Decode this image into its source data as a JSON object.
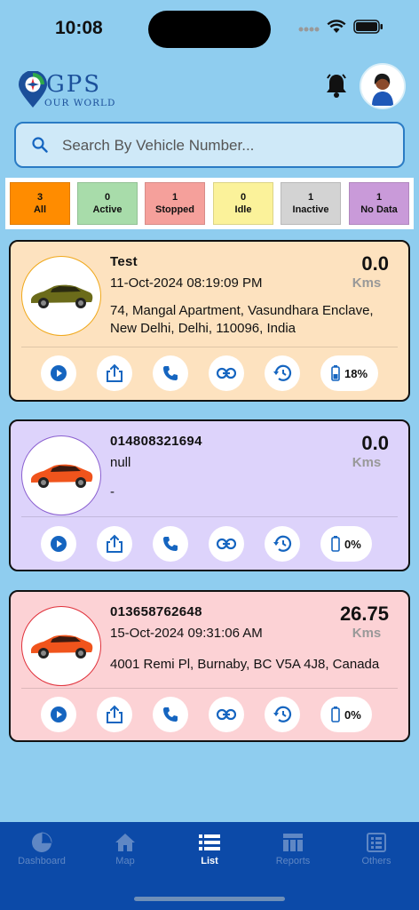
{
  "status_bar": {
    "time": "10:08"
  },
  "header": {
    "logo_main": "GPS",
    "logo_sub": "OUR WORLD"
  },
  "search": {
    "placeholder": "Search By Vehicle Number..."
  },
  "filters": [
    {
      "count": "3",
      "label": "All",
      "color": "#ff8c00"
    },
    {
      "count": "0",
      "label": "Active",
      "color": "#a8dcaa"
    },
    {
      "count": "1",
      "label": "Stopped",
      "color": "#f5a09b"
    },
    {
      "count": "0",
      "label": "Idle",
      "color": "#fbf29a"
    },
    {
      "count": "1",
      "label": "Inactive",
      "color": "#d3d3d3"
    },
    {
      "count": "1",
      "label": "No Data",
      "color": "#c99ad9"
    }
  ],
  "vehicles": [
    {
      "name": "Test",
      "time": "11-Oct-2024 08:19:09 PM",
      "address": "74, Mangal Apartment, Vasundhara Enclave, New Delhi, Delhi, 110096, India",
      "distance": "0.0",
      "unit": "Kms",
      "battery": "18%",
      "card_color": "#fde2bf",
      "ring_color": "#f0a81a",
      "car_color": "#6b6b1a",
      "car_icon": "car-icon"
    },
    {
      "name": "014808321694",
      "time": "null",
      "address": "-",
      "distance": "0.0",
      "unit": "Kms",
      "battery": "0%",
      "card_color": "#ddd3fb",
      "ring_color": "#8a5fd0",
      "car_color": "#f0541c",
      "car_icon": "car-icon"
    },
    {
      "name": "013658762648",
      "time": "15-Oct-2024 09:31:06 AM",
      "address": "4001 Remi Pl, Burnaby, BC V5A 4J8, Canada",
      "distance": "26.75",
      "unit": "Kms",
      "battery": "0%",
      "card_color": "#fcd2d5",
      "ring_color": "#e0303a",
      "car_color": "#f0541c",
      "car_icon": "car-icon"
    }
  ],
  "tabs": [
    {
      "label": "Dashboard",
      "icon": "pie-chart-icon"
    },
    {
      "label": "Map",
      "icon": "home-icon"
    },
    {
      "label": "List",
      "icon": "list-icon",
      "active": true
    },
    {
      "label": "Reports",
      "icon": "table-icon"
    },
    {
      "label": "Others",
      "icon": "grid-list-icon"
    }
  ],
  "colors": {
    "background": "#8fcdef",
    "accent": "#0c4aa8",
    "icon_blue": "#1565c0"
  }
}
